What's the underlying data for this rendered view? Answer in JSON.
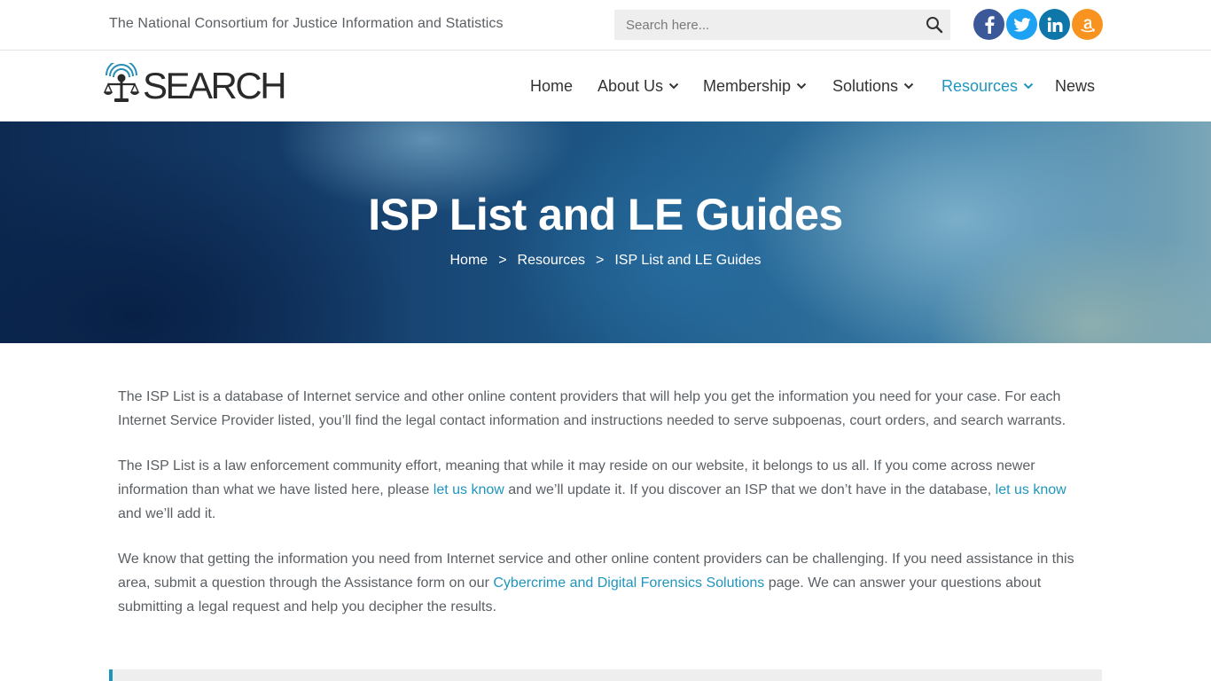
{
  "header": {
    "tagline": "The National Consortium for Justice Information and Statistics",
    "search_placeholder": "Search here...",
    "social": [
      "facebook-icon",
      "twitter-icon",
      "linkedin-icon",
      "amazon-icon"
    ]
  },
  "logo": {
    "text": "SEARCH"
  },
  "nav": {
    "items": [
      {
        "label": "Home"
      },
      {
        "label": "About Us"
      },
      {
        "label": "Membership"
      },
      {
        "label": "Solutions"
      },
      {
        "label": "Resources"
      },
      {
        "label": "News"
      }
    ],
    "active": "Resources"
  },
  "hero": {
    "title": "ISP List and LE Guides",
    "breadcrumb": [
      "Home",
      "Resources",
      "ISP List and LE Guides"
    ],
    "separator": ">"
  },
  "content": {
    "p1": "The ISP List is a database of Internet service and other online content providers that will help you get the information you need for your case. For each Internet Service Provider listed, you’ll find the legal contact information and instructions needed to serve subpoenas, court orders, and search warrants.",
    "p2_a": "The ISP List is a law enforcement community effort, meaning that while it may reside on our website, it belongs to us all. If you come across newer information than what we have listed here, please ",
    "p2_link1": "let us know",
    "p2_b": " and we’ll update it. If you discover an ISP that we don’t have in the database, ",
    "p2_link2": "let us know",
    "p2_c": " and we’ll add it.",
    "p3_a": "We know that getting the information you need from Internet service and other online content providers can be challenging. If you need assistance in this area, submit a question through the Assistance form on our ",
    "p3_link": "Cybercrime and Digital Forensics Solutions",
    "p3_b": " page.  We can answer your questions about submitting a legal request and help you decipher the results."
  },
  "colors": {
    "accent": "#1f95bd",
    "facebook": "#3b5998",
    "twitter": "#1da1f2",
    "linkedin": "#0e76a8",
    "amazon": "#f7931e"
  }
}
